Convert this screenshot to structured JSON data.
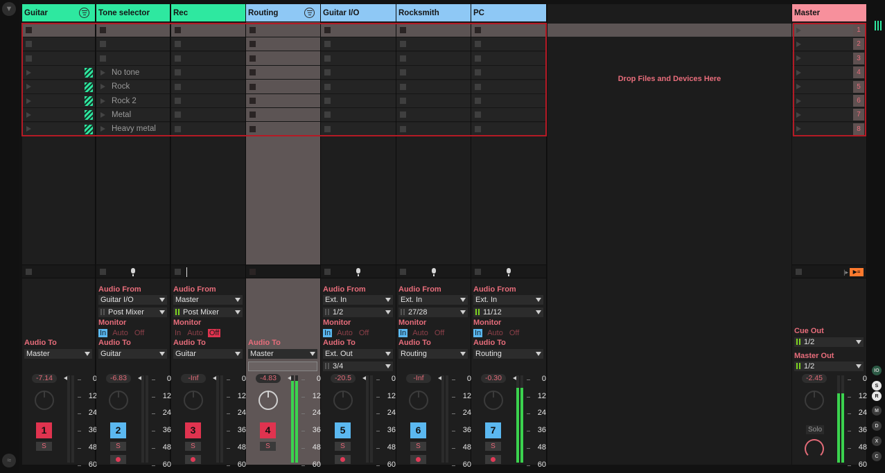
{
  "tracks": [
    {
      "title": "Guitar",
      "num": "1",
      "volume": "-7.14",
      "header_color": "#2ee8a0",
      "num_color": "#e0334f",
      "fold": true,
      "clips": [
        "",
        "",
        "",
        "",
        "",
        "",
        "",
        ""
      ],
      "stripes": [
        false,
        false,
        false,
        true,
        true,
        true,
        true,
        true
      ],
      "audio_to_label": "Audio To",
      "audio_to": "Master"
    },
    {
      "title": "Tone selector",
      "num": "2",
      "volume": "-6.83",
      "header_color": "#2ee8a0",
      "num_color": "#5bb8f0",
      "clips": [
        "",
        "",
        "",
        "No tone",
        "Rock",
        "Rock 2",
        "Metal",
        "Heavy metal"
      ],
      "audio_from_label": "Audio From",
      "audio_from": "Guitar  I/O",
      "audio_from_sub": "Post Mixer",
      "monitor_label": "Monitor",
      "mon_in": "In",
      "mon_auto": "Auto",
      "mon_off": "Off",
      "audio_to_label": "Audio To",
      "audio_to": "Guitar"
    },
    {
      "title": "Rec",
      "num": "3",
      "volume": "-Inf",
      "header_color": "#2ee8a0",
      "num_color": "#e0334f",
      "clips": [
        "",
        "",
        "",
        "",
        "",
        "",
        "",
        ""
      ],
      "audio_from_label": "Audio From",
      "audio_from": "Master",
      "audio_from_sub": "Post Mixer",
      "monitor_label": "Monitor",
      "mon_in": "In",
      "mon_auto": "Auto",
      "mon_off": "Off",
      "audio_to_label": "Audio To",
      "audio_to": "Guitar"
    },
    {
      "title": "Routing",
      "num": "4",
      "volume": "-4.83",
      "header_color": "#8ec8f5",
      "num_color": "#e0334f",
      "fold": true,
      "clips": [
        "",
        "",
        "",
        "",
        "",
        "",
        "",
        ""
      ],
      "audio_to_label": "Audio To",
      "audio_to": "Master"
    },
    {
      "title": "Guitar  I/O",
      "num": "5",
      "volume": "-20.5",
      "header_color": "#8ec8f5",
      "num_color": "#5bb8f0",
      "clips": [
        "",
        "",
        "",
        "",
        "",
        "",
        "",
        ""
      ],
      "audio_from_label": "Audio From",
      "audio_from": "Ext. In",
      "audio_from_sub": "1/2",
      "monitor_label": "Monitor",
      "mon_in": "In",
      "mon_auto": "Auto",
      "mon_off": "Off",
      "audio_to_label": "Audio To",
      "audio_to": "Ext. Out",
      "audio_to_sub": "3/4"
    },
    {
      "title": "Rocksmith",
      "num": "6",
      "volume": "-Inf",
      "header_color": "#8ec8f5",
      "num_color": "#5bb8f0",
      "clips": [
        "",
        "",
        "",
        "",
        "",
        "",
        "",
        ""
      ],
      "audio_from_label": "Audio From",
      "audio_from": "Ext. In",
      "audio_from_sub": "27/28",
      "monitor_label": "Monitor",
      "mon_in": "In",
      "mon_auto": "Auto",
      "mon_off": "Off",
      "audio_to_label": "Audio To",
      "audio_to": "Routing"
    },
    {
      "title": "PC",
      "num": "7",
      "volume": "-0.30",
      "header_color": "#8ec8f5",
      "num_color": "#5bb8f0",
      "clips": [
        "",
        "",
        "",
        "",
        "",
        "",
        "",
        ""
      ],
      "audio_from_label": "Audio From",
      "audio_from": "Ext. In",
      "audio_from_sub": "11/12",
      "monitor_label": "Monitor",
      "mon_in": "In",
      "mon_auto": "Auto",
      "mon_off": "Off",
      "audio_to_label": "Audio To",
      "audio_to": "Routing"
    }
  ],
  "solo_label": "S",
  "scale_ticks": [
    "0",
    "12",
    "24",
    "36",
    "48",
    "60"
  ],
  "dropzone_text": "Drop Files and Devices Here",
  "master": {
    "title": "Master",
    "header_color": "#f7909c",
    "volume": "-2.45",
    "scenes": [
      "1",
      "2",
      "3",
      "4",
      "5",
      "6",
      "7",
      "8"
    ],
    "cue_out_label": "Cue Out",
    "cue_out": "1/2",
    "master_out_label": "Master Out",
    "master_out": "1/2",
    "solo_label": "Solo"
  },
  "colors": {
    "monitor_in": "#5bb8f0",
    "monitor_off": "#e0334f",
    "accent": "#e86d7b",
    "meter": "#3bd24e"
  },
  "right_buttons": [
    "IO",
    "S",
    "R",
    "M",
    "D",
    "X",
    "C"
  ]
}
